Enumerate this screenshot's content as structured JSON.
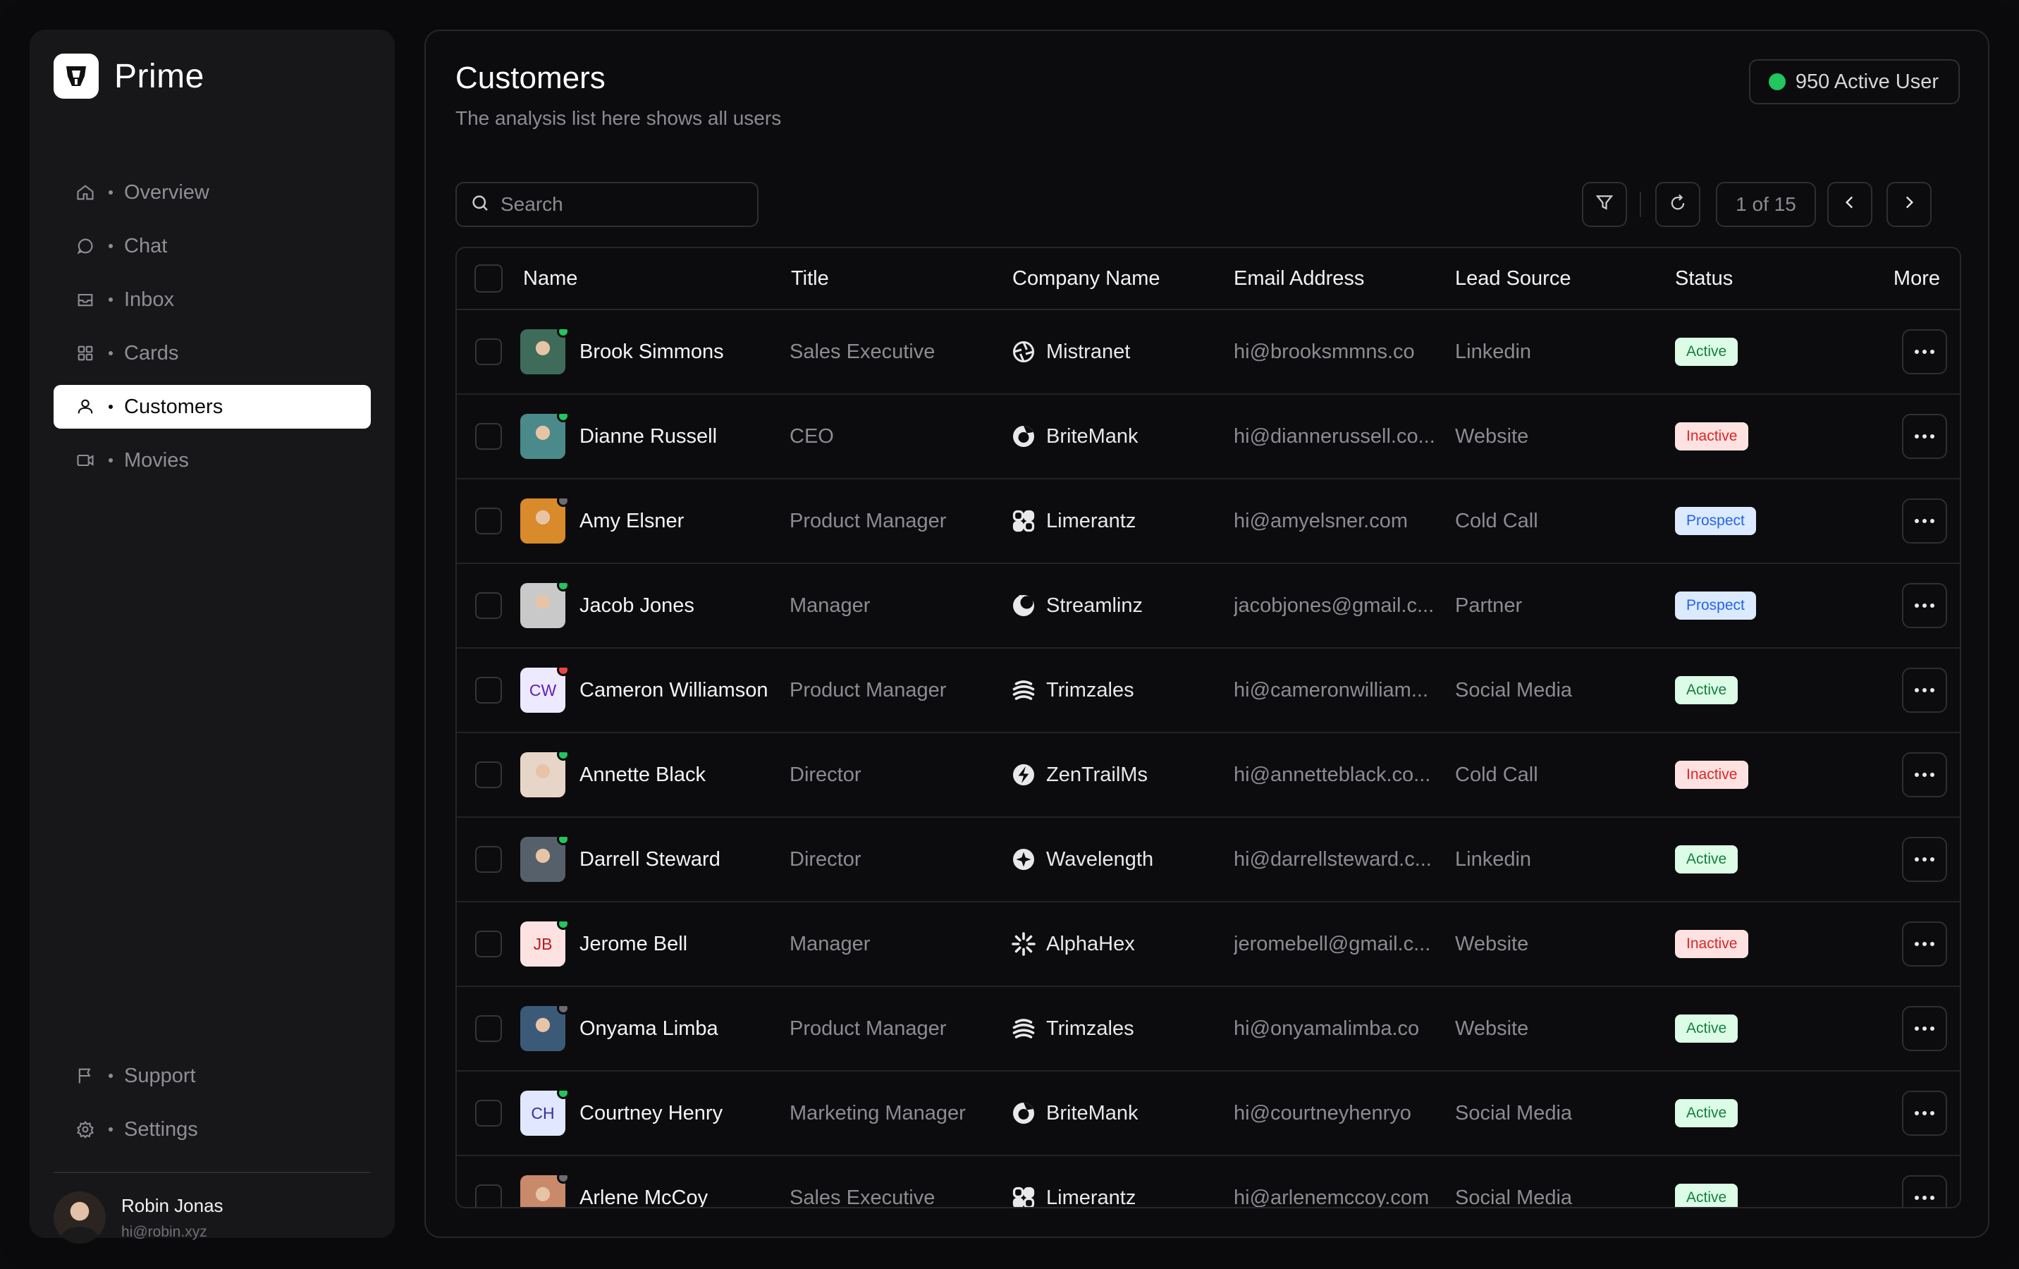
{
  "app": {
    "name": "Prime"
  },
  "nav": {
    "items": [
      {
        "label": "Overview",
        "icon": "home-icon"
      },
      {
        "label": "Chat",
        "icon": "chat-icon"
      },
      {
        "label": "Inbox",
        "icon": "inbox-icon"
      },
      {
        "label": "Cards",
        "icon": "grid-icon"
      },
      {
        "label": "Customers",
        "icon": "user-icon",
        "active": true
      },
      {
        "label": "Movies",
        "icon": "video-icon"
      }
    ],
    "bottom": [
      {
        "label": "Support",
        "icon": "flag-icon"
      },
      {
        "label": "Settings",
        "icon": "gear-icon"
      }
    ]
  },
  "user": {
    "name": "Robin Jonas",
    "email": "hi@robin.xyz"
  },
  "header": {
    "title": "Customers",
    "subtitle": "The analysis list here shows all users",
    "active_users": "950 Active User"
  },
  "toolbar": {
    "search_placeholder": "Search",
    "pagination": "1 of 15"
  },
  "table": {
    "columns": [
      "Name",
      "Title",
      "Company Name",
      "Email Address",
      "Lead Source",
      "Status",
      "More"
    ],
    "rows": [
      {
        "name": "Brook Simmons",
        "title": "Sales Executive",
        "company": "Mistranet",
        "email": "hi@brooksmmns.co",
        "lead": "Linkedin",
        "status": "Active",
        "avatar": "photo",
        "avatar_color": "#3f6b5a",
        "presence": "green",
        "company_icon": "aperture-icon"
      },
      {
        "name": "Dianne Russell",
        "title": "CEO",
        "company": "BriteMank",
        "email": "hi@diannerussell.co...",
        "lead": "Website",
        "status": "Inactive",
        "avatar": "photo",
        "avatar_color": "#4b8a8a",
        "presence": "green",
        "company_icon": "swirl-icon"
      },
      {
        "name": "Amy Elsner",
        "title": "Product Manager",
        "company": "Limerantz",
        "email": "hi@amyelsner.com",
        "lead": "Cold Call",
        "status": "Prospect",
        "avatar": "photo",
        "avatar_color": "#d98a2b",
        "presence": "gray",
        "company_icon": "clover-icon"
      },
      {
        "name": "Jacob Jones",
        "title": "Manager",
        "company": "Streamlinz",
        "email": "jacobjones@gmail.c...",
        "lead": "Partner",
        "status": "Prospect",
        "avatar": "photo",
        "avatar_color": "#c9c9c9",
        "presence": "green",
        "company_icon": "crescent-icon"
      },
      {
        "name": "Cameron Williamson",
        "title": "Product Manager",
        "company": "Trimzales",
        "email": "hi@cameronwilliam...",
        "lead": "Social Media",
        "status": "Active",
        "avatar": "initials",
        "initials": "CW",
        "avatar_color": "#ede9fe",
        "initials_color": "#5b21b6",
        "presence": "red",
        "company_icon": "waves-icon"
      },
      {
        "name": "Annette Black",
        "title": "Director",
        "company": "ZenTrailMs",
        "email": "hi@annetteblack.co...",
        "lead": "Cold Call",
        "status": "Inactive",
        "avatar": "photo",
        "avatar_color": "#e7d6c8",
        "presence": "green",
        "company_icon": "bolt-icon"
      },
      {
        "name": "Darrell Steward",
        "title": "Director",
        "company": "Wavelength",
        "email": "hi@darrellsteward.c...",
        "lead": "Linkedin",
        "status": "Active",
        "avatar": "photo",
        "avatar_color": "#55606b",
        "presence": "green",
        "company_icon": "star-icon"
      },
      {
        "name": "Jerome Bell",
        "title": "Manager",
        "company": "AlphaHex",
        "email": "jeromebell@gmail.c...",
        "lead": "Website",
        "status": "Inactive",
        "avatar": "initials",
        "initials": "JB",
        "avatar_color": "#fee2e2",
        "initials_color": "#b91c1c",
        "presence": "green",
        "company_icon": "burst-icon"
      },
      {
        "name": "Onyama Limba",
        "title": "Product Manager",
        "company": "Trimzales",
        "email": "hi@onyamalimba.co",
        "lead": "Website",
        "status": "Active",
        "avatar": "photo",
        "avatar_color": "#3b5a78",
        "presence": "gray",
        "company_icon": "waves-icon"
      },
      {
        "name": "Courtney Henry",
        "title": "Marketing Manager",
        "company": "BriteMank",
        "email": "hi@courtneyhenryo",
        "lead": "Social Media",
        "status": "Active",
        "avatar": "initials",
        "initials": "CH",
        "avatar_color": "#e0e7ff",
        "initials_color": "#3730a3",
        "presence": "green",
        "company_icon": "swirl-icon"
      },
      {
        "name": "Arlene McCoy",
        "title": "Sales Executive",
        "company": "Limerantz",
        "email": "hi@arlenemccoy.com",
        "lead": "Social Media",
        "status": "Active",
        "avatar": "photo",
        "avatar_color": "#c98a6b",
        "presence": "gray",
        "company_icon": "clover-icon"
      }
    ]
  },
  "colors": {
    "accent_green": "#22c55e",
    "status_active_bg": "#dcfce7",
    "status_inactive_bg": "#fee2e2",
    "status_prospect_bg": "#dbeafe"
  }
}
